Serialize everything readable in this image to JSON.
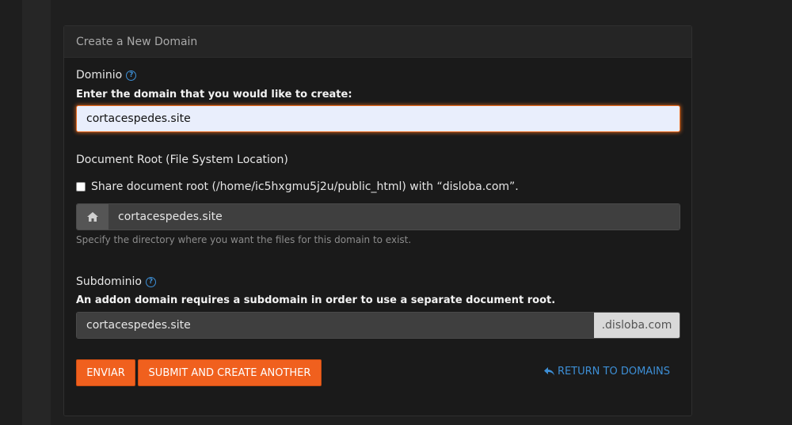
{
  "panel": {
    "title": "Create a New Domain"
  },
  "domain": {
    "label": "Dominio",
    "instruction": "Enter the domain that you would like to create:",
    "value": "cortacespedes.site"
  },
  "document_root": {
    "label": "Document Root (File System Location)",
    "share_label": "Share document root (/home/ic5hxgmu5j2u/public_html) with “disloba.com”.",
    "value": "cortacespedes.site",
    "help": "Specify the directory where you want the files for this domain to exist.",
    "addon_icon": "home-icon"
  },
  "subdomain": {
    "label": "Subdominio",
    "instruction": "An addon domain requires a subdomain in order to use a separate document root.",
    "value": "cortacespedes.site",
    "suffix": ".disloba.com"
  },
  "actions": {
    "submit_label": "Enviar",
    "submit_another_label": "Submit And Create Another",
    "return_label": "Return To Domains"
  },
  "colors": {
    "accent": "#f0601e",
    "link": "#3d8fd6",
    "background": "#1f1f1f",
    "panel": "#1a1a1a"
  }
}
